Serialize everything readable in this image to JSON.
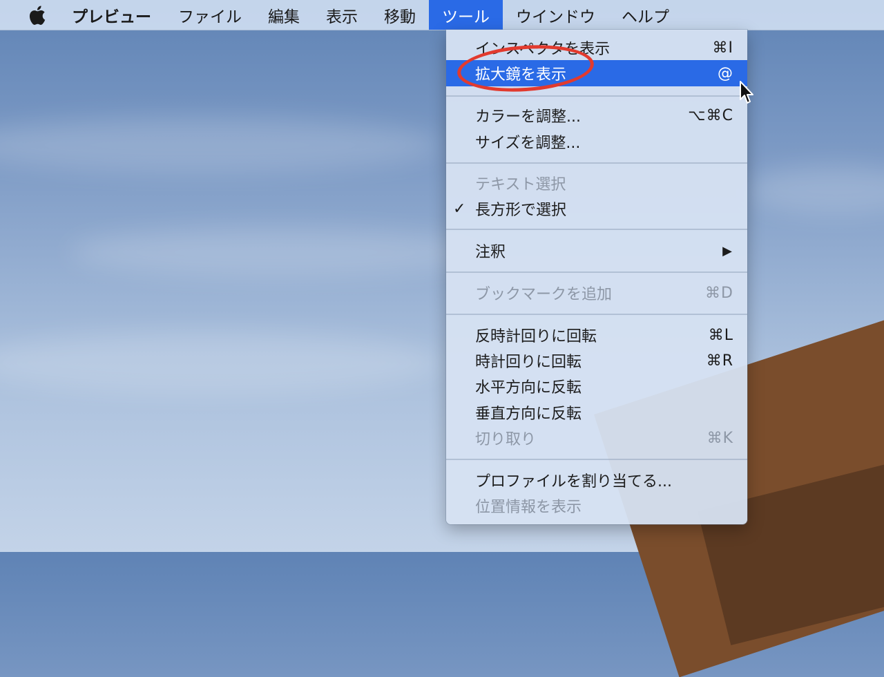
{
  "menubar": {
    "app_name": "プレビュー",
    "items": [
      "ファイル",
      "編集",
      "表示",
      "移動",
      "ツール",
      "ウインドウ",
      "ヘルプ"
    ],
    "active": "ツール"
  },
  "menu": {
    "items": [
      {
        "label": "インスペクタを表示",
        "shortcut": "⌘I",
        "state": "partial-hidden"
      },
      {
        "label": "拡大鏡を表示",
        "shortcut": "@",
        "state": "highlighted"
      },
      {
        "label": "カラーを調整...",
        "shortcut": "⌥⌘C"
      },
      {
        "label": "サイズを調整..."
      },
      {
        "label": "テキスト選択",
        "state": "disabled"
      },
      {
        "label": "長方形で選択",
        "checked": "✓"
      },
      {
        "label": "注釈",
        "submenu": "▶"
      },
      {
        "label": "ブックマークを追加",
        "shortcut": "⌘D",
        "state": "disabled"
      },
      {
        "label": "反時計回りに回転",
        "shortcut": "⌘L"
      },
      {
        "label": "時計回りに回転",
        "shortcut": "⌘R"
      },
      {
        "label": "水平方向に反転"
      },
      {
        "label": "垂直方向に反転"
      },
      {
        "label": "切り取り",
        "shortcut": "⌘K",
        "state": "disabled"
      },
      {
        "label": "プロファイルを割り当てる..."
      },
      {
        "label": "位置情報を表示",
        "state": "disabled"
      }
    ]
  },
  "colors": {
    "highlight": "#2a6ae6",
    "annotation_circle": "#e23a2e"
  },
  "icons": {
    "apple": "apple-logo-icon",
    "cursor": "pointer-cursor-icon"
  }
}
